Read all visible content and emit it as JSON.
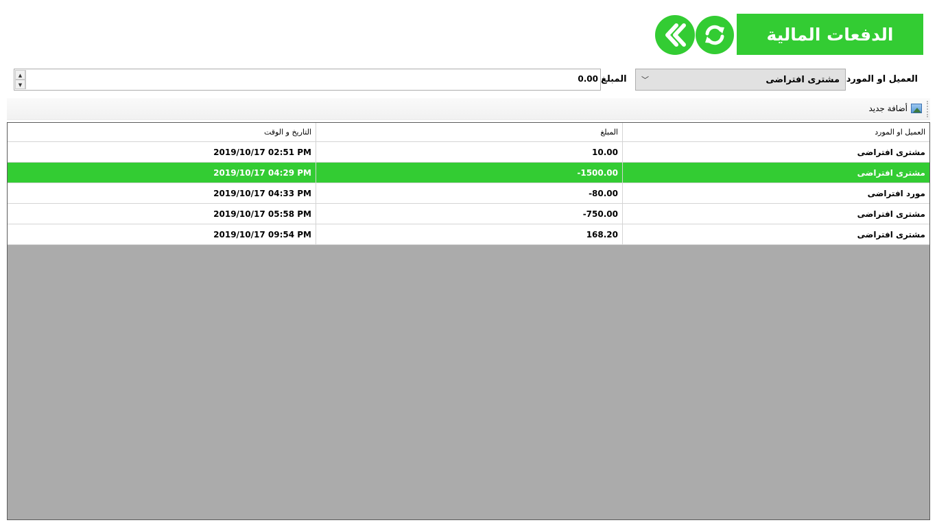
{
  "header": {
    "title": "الدفعات المالية",
    "refresh_icon": "refresh-icon",
    "back_icon": "double-chevron-left-icon"
  },
  "filters": {
    "party_label": "العميل او المورد",
    "party_value": "مشترى افتراضى",
    "amount_label": "المبلغ",
    "amount_value": "0.00"
  },
  "toolbar": {
    "add_new_label": "أضافة جديد",
    "add_new_icon": "image-icon"
  },
  "table": {
    "columns": [
      "العميل او المورد",
      "المبلغ",
      "التاريخ و الوقت"
    ],
    "rows": [
      {
        "party": "مشترى افتراضى",
        "amount": "10.00",
        "datetime": "2019/10/17 02:51 PM"
      },
      {
        "party": "مشترى افتراضى",
        "amount": "-1500.00",
        "datetime": "2019/10/17 04:29 PM"
      },
      {
        "party": "مورد افتراضى",
        "amount": "-80.00",
        "datetime": "2019/10/17 04:33 PM"
      },
      {
        "party": "مشترى افتراضى",
        "amount": "-750.00",
        "datetime": "2019/10/17 05:58 PM"
      },
      {
        "party": "مشترى افتراضى",
        "amount": "168.20",
        "datetime": "2019/10/17 09:54 PM"
      }
    ],
    "selected_row": 2
  },
  "colors": {
    "accent": "#33cc33",
    "grid_background": "#ababab"
  }
}
